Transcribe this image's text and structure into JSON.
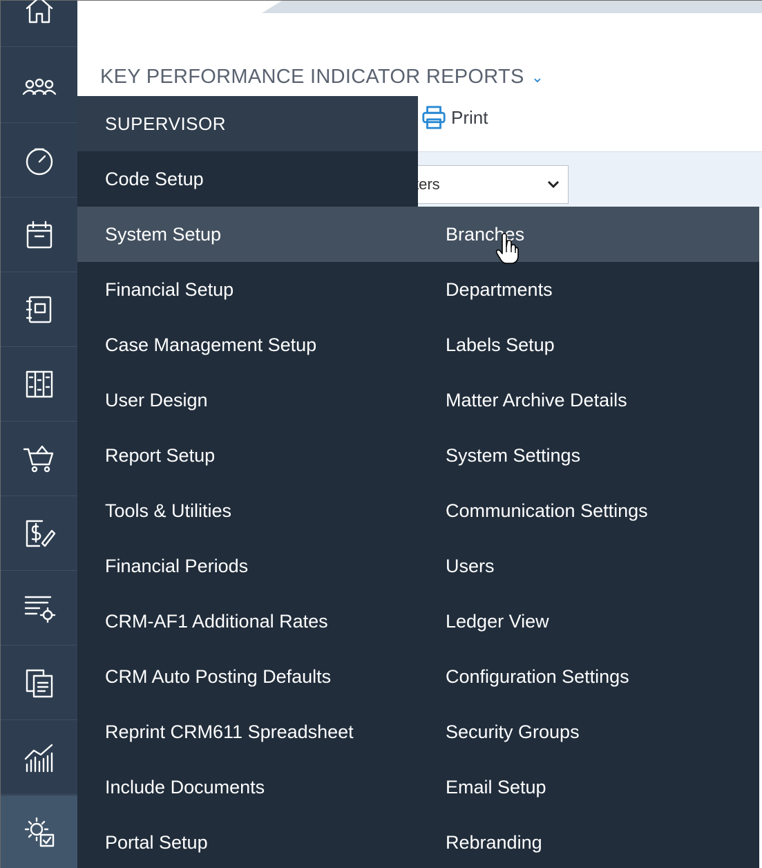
{
  "page": {
    "title": "KEY PERFORMANCE INDICATOR REPORTS",
    "print_label": "Print",
    "filter_value": "ters"
  },
  "rail": {
    "icons": [
      "home-icon",
      "clients-icon",
      "dashboard-icon",
      "calendar-icon",
      "address-book-icon",
      "library-icon",
      "cart-icon",
      "billing-icon",
      "settings-list-icon",
      "documents-icon",
      "reports-chart-icon",
      "supervisor-gear-icon"
    ],
    "active": "supervisor-gear-icon"
  },
  "menu": {
    "header": "SUPERVISOR",
    "left_items": [
      "Code Setup",
      "System Setup",
      "Financial Setup",
      "Case Management Setup",
      "User Design",
      "Report Setup",
      "Tools & Utilities",
      "Financial Periods",
      "CRM-AF1 Additional Rates",
      "CRM Auto Posting Defaults",
      "Reprint CRM611 Spreadsheet",
      "Include Documents",
      "Portal Setup"
    ],
    "highlighted_left": "System Setup",
    "right_items": [
      "Branches",
      "Departments",
      "Labels Setup",
      "Matter Archive Details",
      "System Settings",
      "Communication Settings",
      "Users",
      "Ledger View",
      "Configuration Settings",
      "Security Groups",
      "Email Setup",
      "Rebranding"
    ]
  },
  "colors": {
    "rail": "#2e3e50",
    "menu_bg": "#212d3b",
    "menu_highlight": "#43505f",
    "accent": "#2a8ad4"
  }
}
